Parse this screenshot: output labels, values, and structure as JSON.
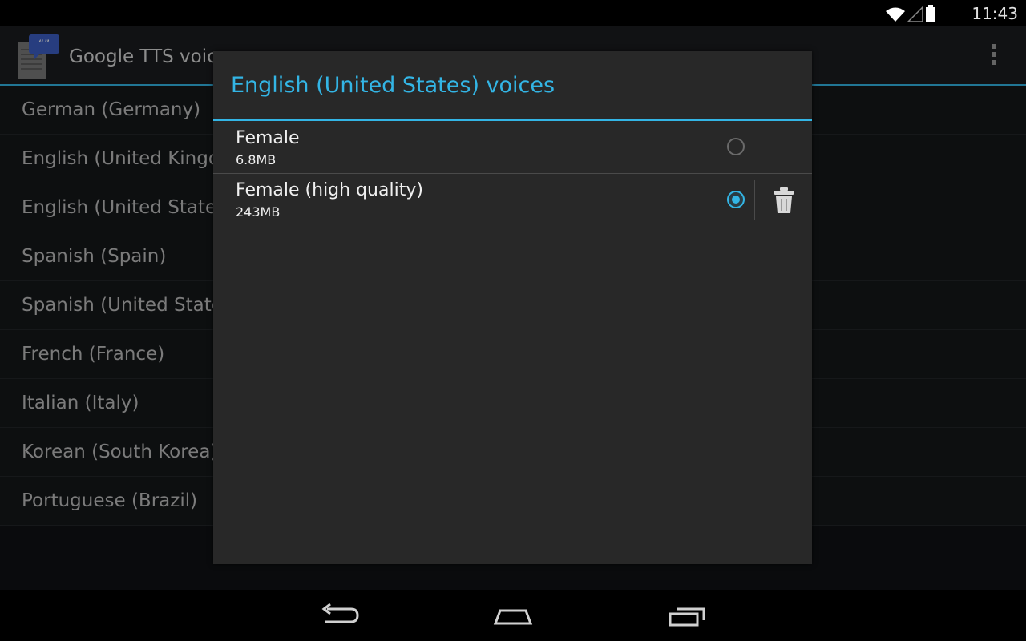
{
  "status_bar": {
    "time": "11:43",
    "icons": [
      "wifi-icon",
      "signal-icon",
      "battery-icon"
    ]
  },
  "action_bar": {
    "title": "Google TTS voices",
    "app_icon": "tts-app-icon",
    "overflow_icon": "overflow-menu-icon"
  },
  "languages": [
    {
      "label": "German (Germany)"
    },
    {
      "label": "English (United Kingdom)"
    },
    {
      "label": "English (United States)"
    },
    {
      "label": "Spanish (Spain)"
    },
    {
      "label": "Spanish (United States)"
    },
    {
      "label": "French (France)"
    },
    {
      "label": "Italian (Italy)"
    },
    {
      "label": "Korean (South Korea)"
    },
    {
      "label": "Portuguese (Brazil)"
    }
  ],
  "dialog": {
    "title": "English (United States) voices",
    "voices": [
      {
        "name": "Female",
        "size": "6.8MB",
        "selected": false,
        "installed": false
      },
      {
        "name": "Female (high quality)",
        "size": "243MB",
        "selected": true,
        "installed": true
      }
    ]
  },
  "nav_bar": {
    "buttons": [
      "back-icon",
      "home-icon",
      "recent-apps-icon"
    ]
  },
  "colors": {
    "accent": "#33b5e5",
    "dialog_bg": "#282828",
    "text_primary": "#f0f0f0",
    "text_secondary": "#bdbdbd"
  }
}
